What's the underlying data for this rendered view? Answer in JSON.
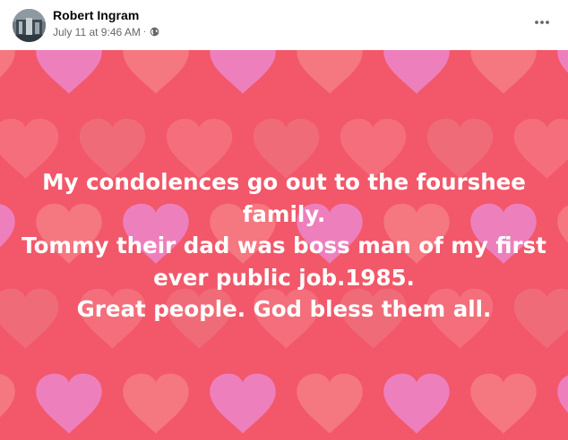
{
  "post": {
    "author": {
      "name": "Robert Ingram",
      "avatar_icon": "profile-photo"
    },
    "timestamp": "July 11 at 9:46 AM",
    "separator": "·",
    "audience_icon": "globe-icon",
    "menu_icon": "more-horizontal-icon",
    "text_lines": [
      "My condolences go out to the fourshee",
      "family.",
      "Tommy their dad was boss man of my first",
      "ever public job.1985.",
      "Great people. God bless them all."
    ],
    "background": {
      "pattern": "hearts",
      "base_color": "#f2586a",
      "heart_colors": [
        "#f57a82",
        "#f06c7a",
        "#ee82c4",
        "#f4707d"
      ]
    }
  }
}
